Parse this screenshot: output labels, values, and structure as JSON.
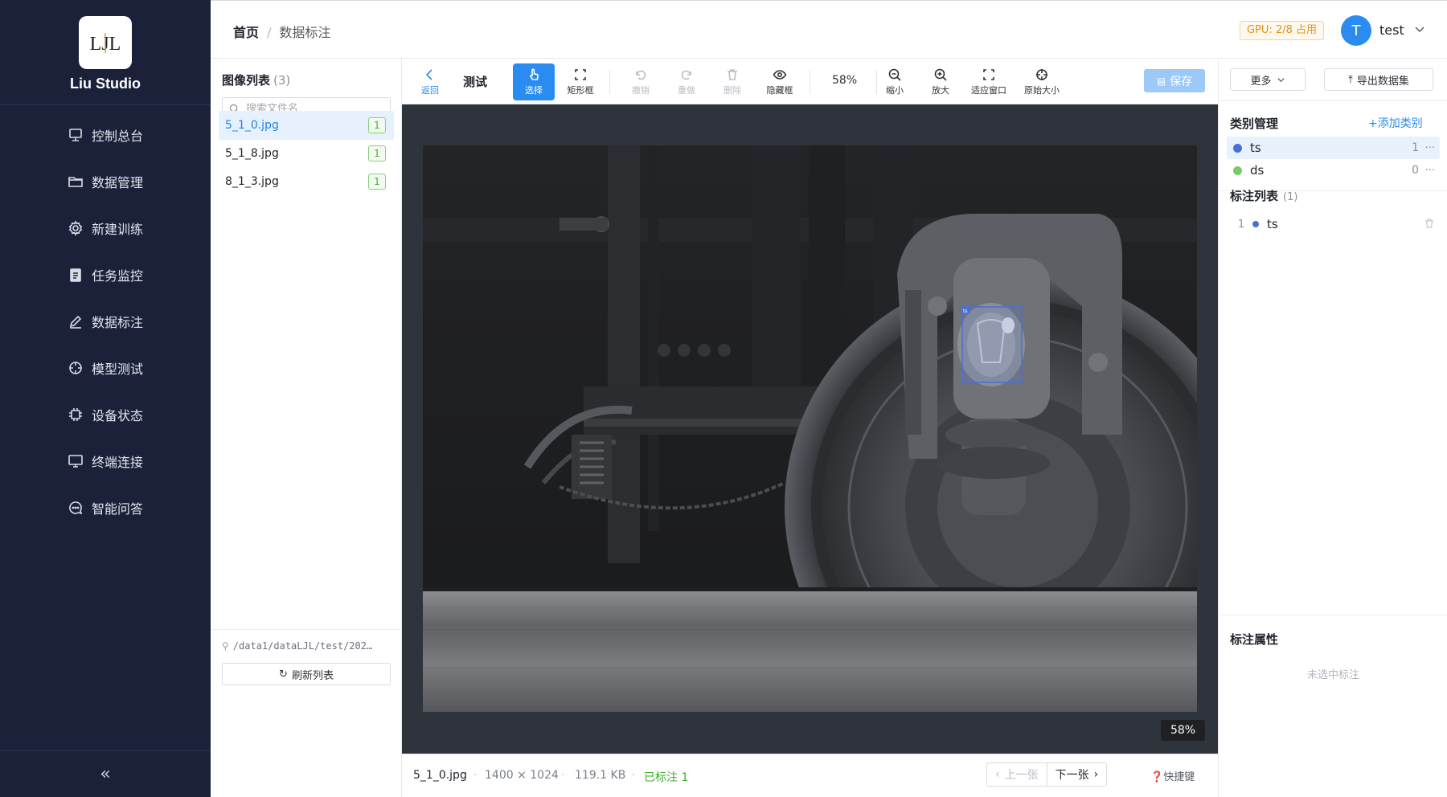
{
  "sidebar": {
    "brand": "Liu Studio",
    "logo_mark": "LJL",
    "items": [
      {
        "label": "控制总台",
        "icon": "monitor-icon"
      },
      {
        "label": "数据管理",
        "icon": "folder-icon"
      },
      {
        "label": "新建训练",
        "icon": "gear-icon"
      },
      {
        "label": "任务监控",
        "icon": "clipboard-icon"
      },
      {
        "label": "数据标注",
        "icon": "pen-icon"
      },
      {
        "label": "模型测试",
        "icon": "crosshair-icon"
      },
      {
        "label": "设备状态",
        "icon": "chip-icon"
      },
      {
        "label": "终端连接",
        "icon": "desktop-icon"
      },
      {
        "label": "智能问答",
        "icon": "chat-icon"
      }
    ],
    "collapse_glyph": "«"
  },
  "header": {
    "breadcrumb_home": "首页",
    "breadcrumb_sep": "/",
    "breadcrumb_current": "数据标注",
    "gpu_badge": "GPU: 2/8 占用",
    "avatar_letter": "T",
    "user_name": "test"
  },
  "image_list": {
    "title": "图像列表",
    "count": "(3)",
    "search_placeholder": "搜索文件名",
    "files": [
      {
        "name": "5_1_0.jpg",
        "count": "1"
      },
      {
        "name": "5_1_8.jpg",
        "count": "1"
      },
      {
        "name": "8_1_3.jpg",
        "count": "1"
      }
    ],
    "path": "/data1/dataLJL/test/202…",
    "refresh_label": "刷新列表"
  },
  "toolbar": {
    "back_label": "返回",
    "project_name": "测试",
    "select_label": "选择",
    "rect_label": "矩形框",
    "undo_label": "撤销",
    "redo_label": "重做",
    "delete_label": "删除",
    "hide_label": "隐藏框",
    "zoom_value": "58%",
    "zoom_out_label": "缩小",
    "zoom_in_label": "放大",
    "fit_label": "适应窗口",
    "original_label": "原始大小",
    "save_label": "保存"
  },
  "canvas": {
    "zoom_pill": "58%",
    "box_label": "ts"
  },
  "statusbar": {
    "filename": "5_1_0.jpg",
    "dimensions": "1400 × 1024",
    "filesize": "119.1 KB",
    "annotated": "已标注 1",
    "prev_label": "上一张",
    "next_label": "下一张",
    "shortcut_label": "快捷键"
  },
  "right_panel": {
    "more_label": "更多",
    "export_label": "导出数据集",
    "category_title": "类别管理",
    "add_category_label": "+添加类别",
    "categories": [
      {
        "name": "ts",
        "count": "1",
        "color": "#4c6fd6"
      },
      {
        "name": "ds",
        "count": "0",
        "color": "#7cc86a"
      }
    ],
    "annotation_title": "标注列表",
    "annotation_count": "(1)",
    "annotations": [
      {
        "index": "1",
        "name": "ts",
        "color": "#4c6fd6"
      }
    ],
    "attr_title": "标注属性",
    "attr_empty": "未选中标注"
  },
  "colors": {
    "sidebar_bg": "#1a2139",
    "accent": "#2a8cf1",
    "success": "#3eae2b",
    "warning": "#e29119"
  }
}
